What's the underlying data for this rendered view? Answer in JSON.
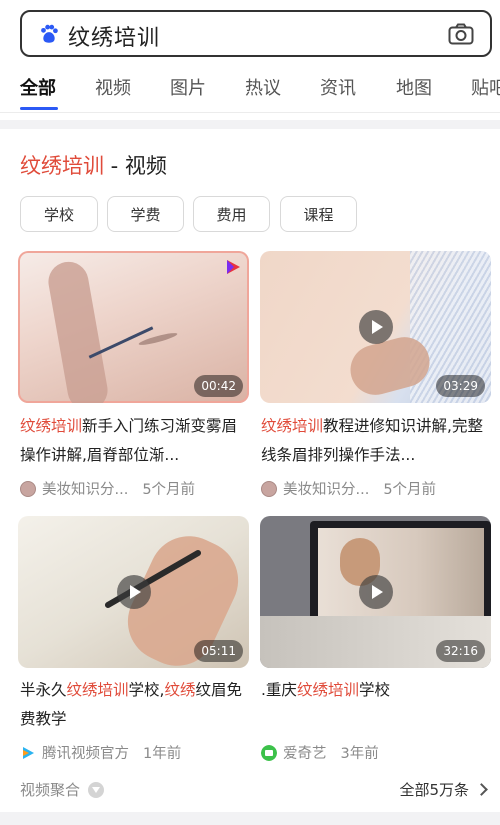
{
  "search": {
    "query": "纹绣培训"
  },
  "tabs": [
    "全部",
    "视频",
    "图片",
    "热议",
    "资讯",
    "地图",
    "贴吧"
  ],
  "section": {
    "title_highlight": "纹绣培训",
    "title_rest": " - 视频"
  },
  "chips": [
    "学校",
    "学费",
    "费用",
    "课程"
  ],
  "videos": [
    {
      "title_html_parts": {
        "hl": "纹绣培训",
        "rest": "新手入门练习渐变雾眉操作讲解,眉脊部位渐..."
      },
      "duration": "00:42",
      "source": "美妆知识分...",
      "time": "5个月前"
    },
    {
      "title_html_parts": {
        "hl": "纹绣培训",
        "rest": "教程进修知识讲解,完整线条眉排列操作手法..."
      },
      "duration": "03:29",
      "source": "美妆知识分...",
      "time": "5个月前"
    },
    {
      "title_html_parts": {
        "pre": "半永久",
        "hl": "纹绣培训",
        "mid": "学校,",
        "hl2": "纹绣",
        "rest": "纹眉免费教学"
      },
      "duration": "05:11",
      "source": "腾讯视频官方",
      "time": "1年前"
    },
    {
      "title_html_parts": {
        "pre": ".重庆",
        "hl": "纹绣培训",
        "rest": "学校"
      },
      "duration": "32:16",
      "source": "爱奇艺",
      "time": "3年前"
    }
  ],
  "footer": {
    "left": "视频聚合",
    "right": "全部5万条"
  },
  "colors": {
    "accent_red": "#e04b3a",
    "tab_underline": "#2b59f5",
    "baidu_blue": "#2b59f5"
  },
  "icons": {
    "search_logo": "baidu-paw-icon",
    "camera": "camera-icon",
    "play": "play-icon",
    "chevron": "chevron-right-icon",
    "collapse": "chevron-down-icon"
  }
}
